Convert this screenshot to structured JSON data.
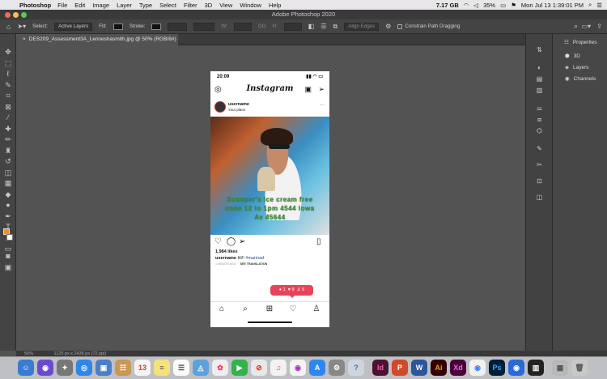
{
  "menubar": {
    "app_name": "Photoshop",
    "items": [
      "File",
      "Edit",
      "Image",
      "Layer",
      "Type",
      "Select",
      "Filter",
      "3D",
      "View",
      "Window",
      "Help"
    ],
    "storage": "7.17 GB",
    "battery": "35%",
    "clock": "Mon Jul 13  1:39:01 PM"
  },
  "window_title": "Adobe Photoshop 2020",
  "options": {
    "select_label": "Select:",
    "select_value": "Active Layers",
    "fill_label": "Fill:",
    "stroke_label": "Stroke:",
    "w_label": "W:",
    "go_label": "GO",
    "h_label": "H:",
    "align_edges": "Align Edges",
    "constrain": "Constrain Path Dragging"
  },
  "document_tab": "DES209_Assessment3A_Lenneshasmith.jpg @ 50% (RGB/8#)",
  "panels": {
    "header": "Properties",
    "items": [
      "3D",
      "Layers",
      "Channels"
    ]
  },
  "status": {
    "zoom": "50%",
    "doc_size": "1125 px x 2436 px (72 ppi)"
  },
  "phone": {
    "time": "20:09",
    "logo": "Instagram",
    "username": "username",
    "place": "Your place",
    "overlay_lines": [
      "Scooper's Ice cream free",
      "cone 12 to 1pm 4544 Iowa",
      "Av 45644"
    ],
    "likes": "1,984 likes",
    "caption_user": "username",
    "caption_text": "Hi!!",
    "caption_tag": "#marinad",
    "posted": "1 MINUTE AGO",
    "translation": "SEE TRANSLATION",
    "notifications": {
      "comments": "1",
      "likes": "9",
      "follows": "5"
    }
  },
  "colors": {
    "foreground": "#e8941b",
    "background": "#ffffff",
    "notif": "#e8435a",
    "overlay_text": "#3f8a3a"
  }
}
